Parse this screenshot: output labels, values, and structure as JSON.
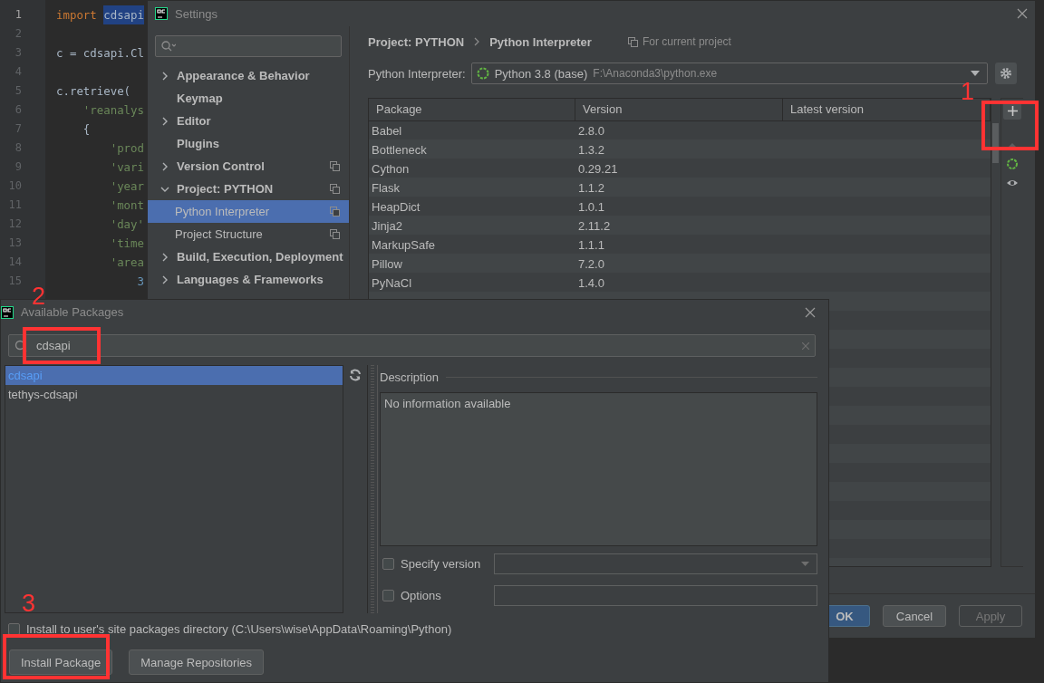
{
  "editor": {
    "lines": [
      {
        "number": "1",
        "tokens": [
          {
            "text": "import ",
            "kind": "keyword"
          },
          {
            "text": "cdsapi",
            "kind": "highlight"
          }
        ]
      },
      {
        "number": "2"
      },
      {
        "number": "3",
        "tokens": [
          {
            "text": "c = cdsapi.Cl",
            "kind": "plain"
          }
        ]
      },
      {
        "number": "4"
      },
      {
        "number": "5",
        "tokens": [
          {
            "text": "c.retrieve(",
            "kind": "plain"
          }
        ]
      },
      {
        "number": "6",
        "tokens": [
          {
            "text": "    'reanalys",
            "kind": "string"
          }
        ]
      },
      {
        "number": "7",
        "tokens": [
          {
            "text": "    {",
            "kind": "plain"
          }
        ]
      },
      {
        "number": "8",
        "tokens": [
          {
            "text": "        'prod",
            "kind": "string"
          }
        ]
      },
      {
        "number": "9",
        "tokens": [
          {
            "text": "        'vari",
            "kind": "string"
          }
        ]
      },
      {
        "number": "10",
        "tokens": [
          {
            "text": "        'year",
            "kind": "string"
          }
        ]
      },
      {
        "number": "11",
        "tokens": [
          {
            "text": "        'mont",
            "kind": "string"
          }
        ]
      },
      {
        "number": "12",
        "tokens": [
          {
            "text": "        'day'",
            "kind": "string"
          }
        ]
      },
      {
        "number": "13",
        "tokens": [
          {
            "text": "        'time",
            "kind": "string"
          }
        ]
      },
      {
        "number": "14",
        "tokens": [
          {
            "text": "        'area",
            "kind": "string"
          }
        ]
      },
      {
        "number": "15",
        "tokens": [
          {
            "text": "            3",
            "kind": "number"
          }
        ]
      }
    ]
  },
  "settings": {
    "title": "Settings",
    "sidebar": {
      "items": [
        {
          "label": "Appearance & Behavior",
          "kind": "group",
          "expanded": false,
          "selected": false
        },
        {
          "label": "Keymap",
          "kind": "leaf",
          "selected": false
        },
        {
          "label": "Editor",
          "kind": "group",
          "expanded": false,
          "selected": false
        },
        {
          "label": "Plugins",
          "kind": "leaf",
          "selected": false
        },
        {
          "label": "Version Control",
          "kind": "group",
          "expanded": false,
          "selected": false,
          "project_level": true
        },
        {
          "label": "Project: PYTHON",
          "kind": "group",
          "expanded": true,
          "selected": false,
          "project_level": true,
          "children": [
            {
              "label": "Python Interpreter",
              "selected": true,
              "project_level": true
            },
            {
              "label": "Project Structure",
              "selected": false,
              "project_level": true
            }
          ]
        },
        {
          "label": "Build, Execution, Deployment",
          "kind": "group",
          "expanded": false,
          "selected": false
        },
        {
          "label": "Languages & Frameworks",
          "kind": "group",
          "expanded": false,
          "selected": false
        }
      ]
    },
    "breadcrumb": [
      "Project: PYTHON",
      "Python Interpreter"
    ],
    "scope": "For current project",
    "interpreter": {
      "label": "Python Interpreter:",
      "name": "Python 3.8 (base)",
      "path": "F:\\Anaconda3\\python.exe"
    },
    "table": {
      "columns": [
        "Package",
        "Version",
        "Latest version"
      ],
      "rows": [
        {
          "package": "Babel",
          "version": "2.8.0"
        },
        {
          "package": "Bottleneck",
          "version": "1.3.2"
        },
        {
          "package": "Cython",
          "version": "0.29.21"
        },
        {
          "package": "Flask",
          "version": "1.1.2"
        },
        {
          "package": "HeapDict",
          "version": "1.0.1"
        },
        {
          "package": "Jinja2",
          "version": "2.11.2"
        },
        {
          "package": "MarkupSafe",
          "version": "1.1.1"
        },
        {
          "package": "Pillow",
          "version": "7.2.0"
        },
        {
          "package": "PyNaCl",
          "version": "1.4.0"
        }
      ]
    },
    "buttons": [
      {
        "label": "OK",
        "kind": "primary",
        "disabled": false
      },
      {
        "label": "Cancel",
        "kind": "normal",
        "disabled": false
      },
      {
        "label": "Apply",
        "kind": "normal",
        "disabled": true
      }
    ]
  },
  "dialog": {
    "title": "Available Packages",
    "search": {
      "value": "cdsapi"
    },
    "results": [
      {
        "name": "cdsapi",
        "selected": true
      },
      {
        "name": "tethys-cdsapi",
        "selected": false
      }
    ],
    "description": {
      "heading": "Description",
      "text": "No information available"
    },
    "specify_version": {
      "label": "Specify version",
      "checked": false
    },
    "options": {
      "label": "Options",
      "checked": false
    },
    "install_to_user": {
      "label": "Install to user's site packages directory (C:\\Users\\wise\\AppData\\Roaming\\Python)",
      "checked": false
    },
    "buttons": [
      "Install Package",
      "Manage Repositories"
    ]
  },
  "annotations": [
    {
      "label": "1"
    },
    {
      "label": "2"
    },
    {
      "label": "3"
    }
  ]
}
